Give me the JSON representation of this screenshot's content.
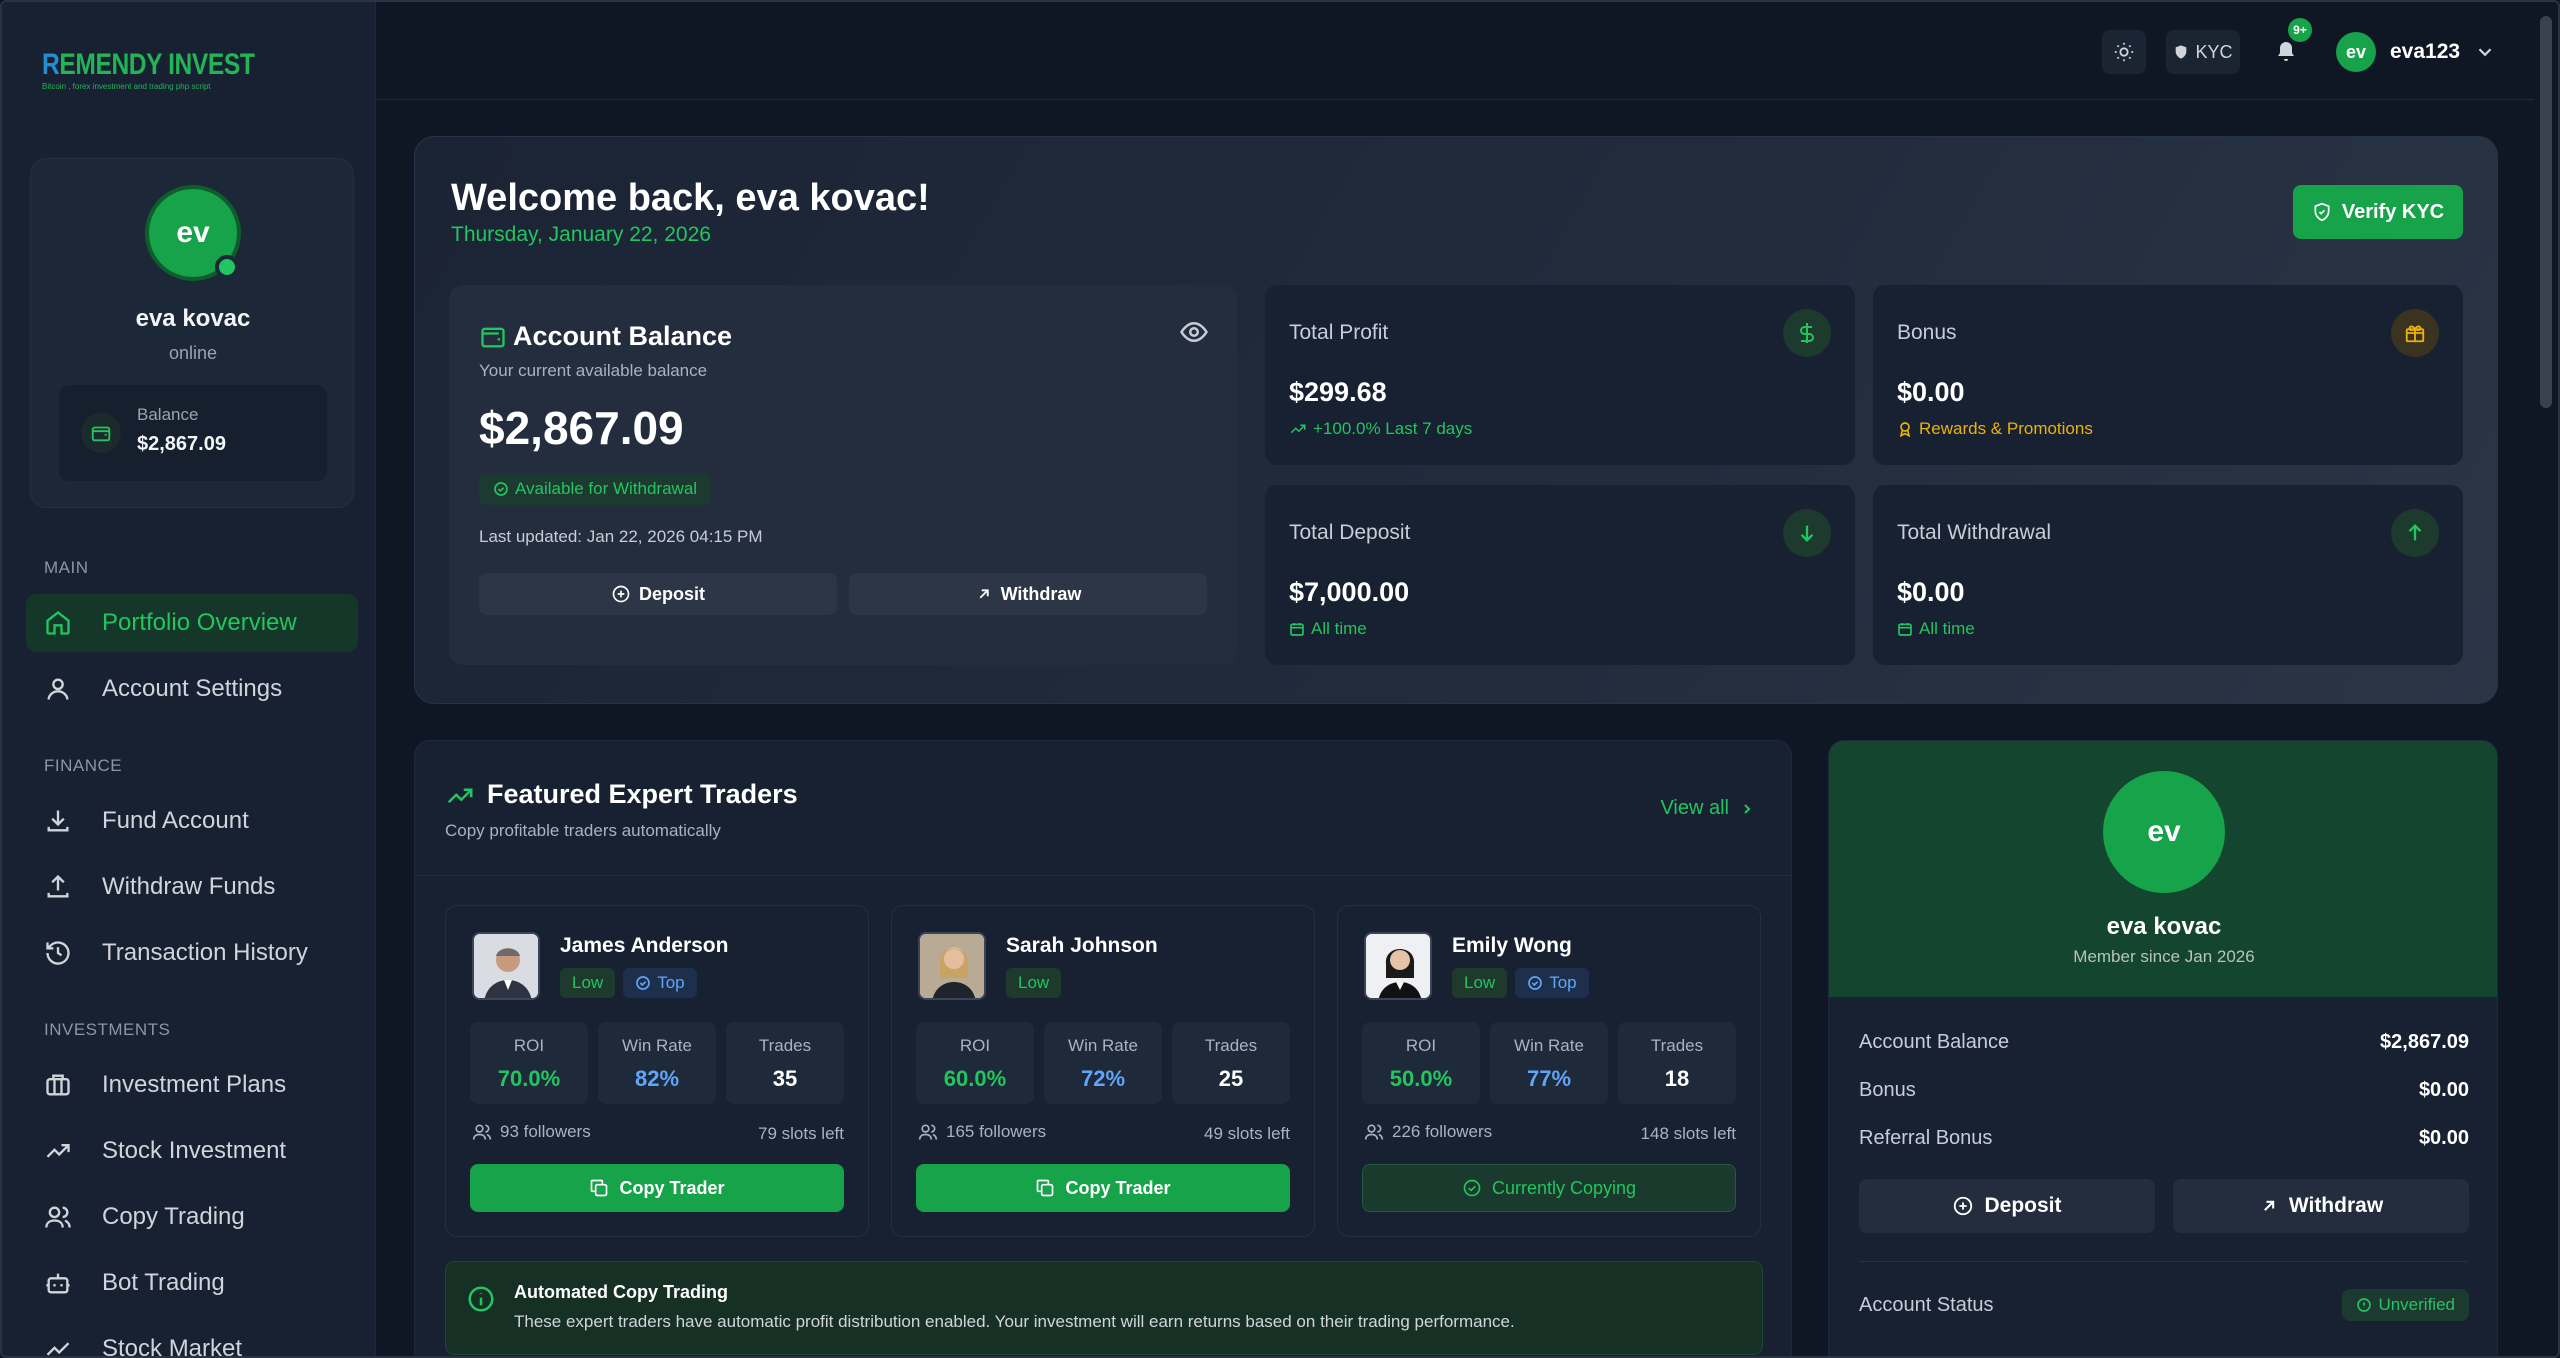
{
  "brand": {
    "logo_text": "EMENDY INVEST",
    "logo_initial": "R",
    "tagline": "Bitcoin , forex investment and trading php script"
  },
  "sidebar": {
    "user": {
      "initials": "ev",
      "name": "eva kovac",
      "status": "online",
      "balance_label": "Balance",
      "balance_value": "$2,867.09"
    },
    "sections": {
      "main": "MAIN",
      "finance": "FINANCE",
      "investments": "INVESTMENTS"
    },
    "items": [
      {
        "label": "Portfolio Overview",
        "icon": "home-icon",
        "active": true
      },
      {
        "label": "Account Settings",
        "icon": "user-icon"
      },
      {
        "label": "Fund Account",
        "icon": "download-icon"
      },
      {
        "label": "Withdraw Funds",
        "icon": "upload-icon"
      },
      {
        "label": "Transaction History",
        "icon": "history-icon"
      },
      {
        "label": "Investment Plans",
        "icon": "briefcase-icon"
      },
      {
        "label": "Stock Investment",
        "icon": "trending-up-icon"
      },
      {
        "label": "Copy Trading",
        "icon": "users-icon"
      },
      {
        "label": "Bot Trading",
        "icon": "bot-icon"
      },
      {
        "label": "Stock Market",
        "icon": "chart-icon"
      }
    ]
  },
  "topbar": {
    "kyc_label": "KYC",
    "notif_count": "9+",
    "user_initials": "ev",
    "username": "eva123"
  },
  "welcome": {
    "title": "Welcome back, eva kovac!",
    "date": "Thursday, January 22, 2026",
    "verify_label": "Verify KYC",
    "account": {
      "title": "Account Balance",
      "subtitle": "Your current available balance",
      "value": "$2,867.09",
      "available": "Available for Withdrawal",
      "last_updated": "Last updated: Jan 22, 2026 04:15 PM",
      "deposit": "Deposit",
      "withdraw": "Withdraw"
    },
    "stats": [
      {
        "label": "Total Profit",
        "value": "$299.68",
        "sub": "+100.0% Last 7 days",
        "icon": "dollar-icon",
        "color": "#22c55e"
      },
      {
        "label": "Bonus",
        "value": "$0.00",
        "sub": "Rewards & Promotions",
        "icon": "gift-icon",
        "color": "#eab308"
      },
      {
        "label": "Total Deposit",
        "value": "$7,000.00",
        "sub": "All time",
        "icon": "arrow-down-icon",
        "color": "#22c55e"
      },
      {
        "label": "Total Withdrawal",
        "value": "$0.00",
        "sub": "All time",
        "icon": "arrow-up-icon",
        "color": "#22c55e"
      }
    ]
  },
  "traders": {
    "title": "Featured Expert Traders",
    "subtitle": "Copy profitable traders automatically",
    "view_all": "View all",
    "metric_labels": {
      "roi": "ROI",
      "win": "Win Rate",
      "trades": "Trades"
    },
    "list": [
      {
        "name": "James Anderson",
        "risk": "Low",
        "top": "Top",
        "roi": "70.0%",
        "win": "82%",
        "trades": "35",
        "followers": "93 followers",
        "slots": "79 slots left",
        "action": "Copy Trader"
      },
      {
        "name": "Sarah Johnson",
        "risk": "Low",
        "top": "",
        "roi": "60.0%",
        "win": "72%",
        "trades": "25",
        "followers": "165 followers",
        "slots": "49 slots left",
        "action": "Copy Trader"
      },
      {
        "name": "Emily Wong",
        "risk": "Low",
        "top": "Top",
        "roi": "50.0%",
        "win": "77%",
        "trades": "18",
        "followers": "226 followers",
        "slots": "148 slots left",
        "action": "Currently Copying"
      }
    ],
    "auto": {
      "title": "Automated Copy Trading",
      "desc": "These expert traders have automatic profit distribution enabled. Your investment will earn returns based on their trading performance."
    }
  },
  "profile_panel": {
    "initials": "ev",
    "name": "eva kovac",
    "since": "Member since Jan 2026",
    "rows": [
      {
        "k": "Account Balance",
        "v": "$2,867.09"
      },
      {
        "k": "Bonus",
        "v": "$0.00"
      },
      {
        "k": "Referral Bonus",
        "v": "$0.00"
      }
    ],
    "deposit": "Deposit",
    "withdraw": "Withdraw",
    "status_label": "Account Status",
    "status_value": "Unverified"
  },
  "colors": {
    "accent": "#16a34a",
    "accent_text": "#22c55e",
    "blue": "#60a5fa",
    "gold": "#eab308"
  }
}
